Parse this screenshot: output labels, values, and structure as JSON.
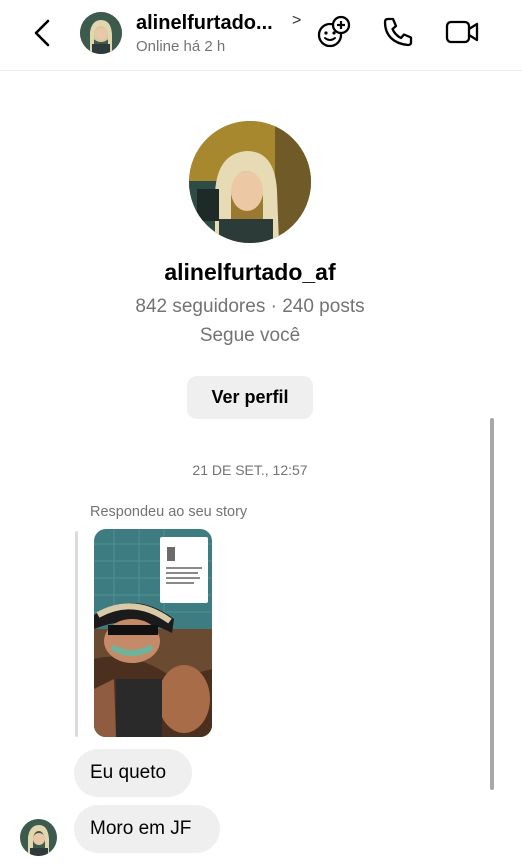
{
  "header": {
    "username": "alinelfurtado...",
    "chevron": ">",
    "status": "Online há 2 h",
    "icons": [
      "back-icon",
      "add-people-icon",
      "phone-icon",
      "video-icon"
    ]
  },
  "profile": {
    "username": "alinelfurtado_af",
    "stats": "842 seguidores · 240 posts",
    "follows_you": "Segue você",
    "view_profile_label": "Ver perfil"
  },
  "conversation": {
    "timestamp": "21 DE SET., 12:57",
    "reply_label": "Respondeu ao seu story",
    "messages": [
      {
        "text": "Eu queto"
      },
      {
        "text": "Moro em JF"
      }
    ]
  },
  "colors": {
    "bubble": "#efefef",
    "secondary_text": "#737373",
    "divider": "#ececec"
  }
}
